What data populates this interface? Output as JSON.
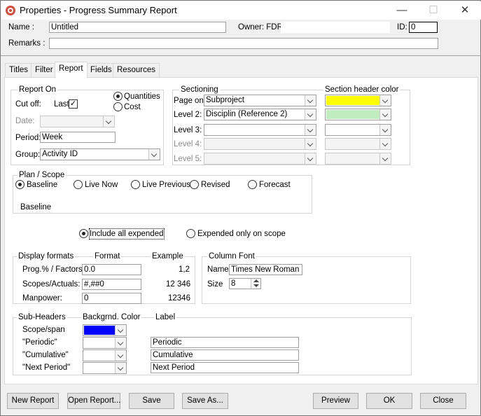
{
  "window": {
    "title": "Properties - Progress Summary Report",
    "buttons": {
      "minimize": "—",
      "maximize": "☐",
      "close": "✕"
    }
  },
  "header": {
    "name_label": "Name :",
    "name_value": "Untitled",
    "owner_label": "Owner: FDR",
    "id_label": "ID:",
    "id_value": "0",
    "remarks_label": "Remarks :",
    "remarks_value": ""
  },
  "tabs": [
    "Titles",
    "Filter",
    "Report",
    "Fields",
    "Resources"
  ],
  "report_on": {
    "title": "Report On",
    "quantities": "Quantities",
    "cost": "Cost",
    "cutoff_label": "Cut off:",
    "last_label": "Last",
    "last_check": "✓",
    "date_label": "Date:",
    "date_value": "",
    "period_label": "Period:",
    "period_value": "Week",
    "group_label": "Group:",
    "group_value": "Activity ID"
  },
  "sectioning": {
    "title": "Sectioning",
    "color_title": "Section header color",
    "rows": [
      {
        "label": "Page on",
        "value": "Subproject",
        "color": "#ffff00"
      },
      {
        "label": "Level 2:",
        "value": "Disciplin (Reference 2)",
        "color": "#c0ecc0"
      },
      {
        "label": "Level 3:",
        "value": "",
        "color": ""
      },
      {
        "label": "Level 4:",
        "value": "",
        "color": ""
      },
      {
        "label": "Level 5:",
        "value": "",
        "color": ""
      }
    ]
  },
  "plan_scope": {
    "title": "Plan / Scope",
    "options": [
      "Baseline",
      "Live Now",
      "Live Previous",
      "Revised",
      "Forecast"
    ],
    "selected_text": "Baseline"
  },
  "expended": {
    "include_all": "Include all expended",
    "only_scope": "Expended only on scope"
  },
  "display_formats": {
    "title": "Display formats",
    "format_header": "Format",
    "example_header": "Example",
    "rows": [
      {
        "label": "Prog.% / Factors:",
        "format": "0.0",
        "example": "1,2"
      },
      {
        "label": "Scopes/Actuals:",
        "format": "#,##0",
        "example": "12 346"
      },
      {
        "label": "Manpower:",
        "format": "0",
        "example": "12346"
      }
    ]
  },
  "column_font": {
    "title": "Column Font",
    "name_label": "Name",
    "name_value": "Times New Roman",
    "size_label": "Size",
    "size_value": "8"
  },
  "sub_headers": {
    "title": "Sub-Headers",
    "bg_header": "Backgrnd. Color",
    "label_header": "Label",
    "rows": [
      {
        "label": "Scope/span",
        "color": "#0000ff",
        "text": ""
      },
      {
        "label": "\"Periodic\"",
        "color": "",
        "text": "Periodic"
      },
      {
        "label": "\"Cumulative\"",
        "color": "",
        "text": "Cumulative"
      },
      {
        "label": "\"Next Period\"",
        "color": "",
        "text": "Next Period"
      }
    ]
  },
  "footer": {
    "new_report": "New Report",
    "open_report": "Open Report...",
    "save": "Save",
    "save_as": "Save As...",
    "preview": "Preview",
    "ok": "OK",
    "close": "Close"
  }
}
